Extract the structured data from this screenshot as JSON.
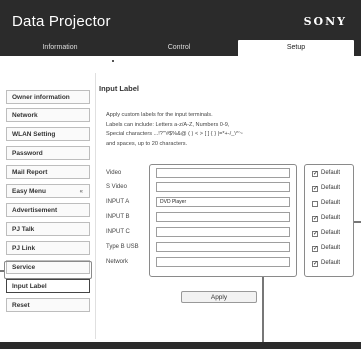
{
  "header": {
    "app_title": "Data Projector",
    "brand": "SONY"
  },
  "tabs": [
    {
      "label": "Information",
      "active": false
    },
    {
      "label": "Control",
      "active": false
    },
    {
      "label": "Setup",
      "active": true
    }
  ],
  "sidebar": {
    "items": [
      {
        "label": "Owner information"
      },
      {
        "label": "Network"
      },
      {
        "label": "WLAN Setting"
      },
      {
        "label": "Password"
      },
      {
        "label": "Mail Report"
      },
      {
        "label": "Easy Menu",
        "chevron": "«"
      },
      {
        "label": "Advertisement"
      },
      {
        "label": "PJ Talk"
      },
      {
        "label": "PJ Link"
      },
      {
        "label": "Service"
      },
      {
        "label": "Input Label",
        "active": true
      },
      {
        "label": "Reset"
      }
    ]
  },
  "main": {
    "title": "Input Label",
    "description_lines": [
      "Apply custom labels for the input terminals.",
      "Labels can include: Letters a-z/A-Z, Numbers 0-9,",
      "Special characters ...!?\"'#$%&@ ( ) < > [ ] { } |=*+-/_\\^'~",
      "and spaces, up to 20 characters."
    ],
    "rows": [
      {
        "terminal": "Video",
        "value": "",
        "default_label": "Default",
        "default_checked": true
      },
      {
        "terminal": "S Video",
        "value": "",
        "default_label": "Default",
        "default_checked": true
      },
      {
        "terminal": "INPUT A",
        "value": "DVD Player",
        "default_label": "Default",
        "default_checked": false
      },
      {
        "terminal": "INPUT B",
        "value": "",
        "default_label": "Default",
        "default_checked": true
      },
      {
        "terminal": "INPUT C",
        "value": "",
        "default_label": "Default",
        "default_checked": true
      },
      {
        "terminal": "Type B USB",
        "value": "",
        "default_label": "Default",
        "default_checked": true
      },
      {
        "terminal": "Network",
        "value": "",
        "default_label": "Default",
        "default_checked": true
      }
    ],
    "apply_label": "Apply"
  },
  "colors": {
    "header_bg": "#2b2b2b",
    "active_tab_bg": "#ffffff",
    "callout_border": "#8a8a8a"
  }
}
